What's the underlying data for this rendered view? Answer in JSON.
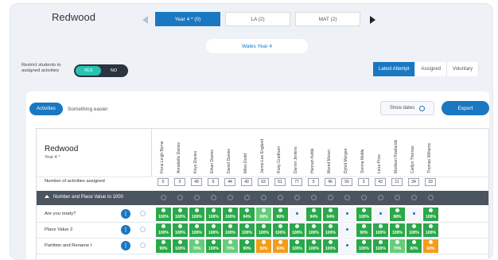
{
  "school_name": "Redwood",
  "tabs": [
    {
      "label": "Year 4 * (0)",
      "active": true
    },
    {
      "label": "LA (2)",
      "active": false
    },
    {
      "label": "MAT (2)",
      "active": false
    }
  ],
  "class_title": "Wales Year 4",
  "restrict": {
    "label": "Restrict students to assigned activities",
    "yes": "YES",
    "no": "NO"
  },
  "attempt_tabs": [
    "Latest Attempt",
    "Assigned",
    "Voluntary"
  ],
  "panel": {
    "activities_btn": "Activities",
    "easier_btn": "Something easier",
    "show_dates_btn": "Show dates",
    "export_btn": "Export"
  },
  "grid": {
    "title": "Redwood",
    "subtitle": "Year 4 *",
    "count_label": "Number of activities assigned",
    "section_label": "Number and Place Value to 1000",
    "students": [
      "Fiona Leigh Byrne",
      "Annabelle Davies",
      "Keyo Davies",
      "Ethan Davies",
      "Daniel Davies",
      "Miles Dodd",
      "Jamie-Lee England",
      "Ruby Gradham",
      "Darren Jenkins",
      "Hannah Kettle",
      "Mared Moran",
      "Dyfed Morgan",
      "Sienna Mottle",
      "Lena Price",
      "Madison Rowlands",
      "Caitlyn Thomas",
      "Thomas Williams"
    ],
    "counts": [
      "0",
      "0",
      "49",
      "6",
      "44",
      "40",
      "63",
      "51",
      "77",
      "0",
      "46",
      "50",
      "3",
      "43",
      "11",
      "34",
      "33"
    ],
    "rows": [
      {
        "label": "Are you ready?",
        "cells": [
          "g1:100%",
          "g1:100%",
          "g1:100%",
          "g1:100%",
          "g1:100%",
          "g1:94%",
          "g2:69%",
          "g1:88%",
          "e:",
          "g1:94%",
          "g1:94%",
          "e:",
          "g1:100%",
          "e:",
          "g1:88%",
          "e:",
          "g1:100%"
        ]
      },
      {
        "label": "Place Value 2",
        "cells": [
          "g1:100%",
          "g1:100%",
          "g1:100%",
          "g1:100%",
          "g1:100%",
          "g1:100%",
          "g1:100%",
          "g1:100%",
          "g1:100%",
          "g1:100%",
          "g1:100%",
          "e:",
          "g1:90%",
          "g1:100%",
          "g1:100%",
          "g1:100%",
          "g1:100%"
        ]
      },
      {
        "label": "Partition and Rename I",
        "cells": [
          "g1:90%",
          "g1:100%",
          "g2:70%",
          "g1:100%",
          "g2:70%",
          "g1:90%",
          "o1:50%",
          "o1:60%",
          "g1:100%",
          "g1:100%",
          "g1:100%",
          "e:",
          "g1:100%",
          "g1:100%",
          "g2:70%",
          "g1:80%",
          "o1:60%"
        ]
      }
    ]
  },
  "colors": {
    "primary": "#1a78c2",
    "green": "#2aa84a",
    "light_green": "#66cc7a",
    "orange": "#f39c1d",
    "section": "#4b5560"
  }
}
